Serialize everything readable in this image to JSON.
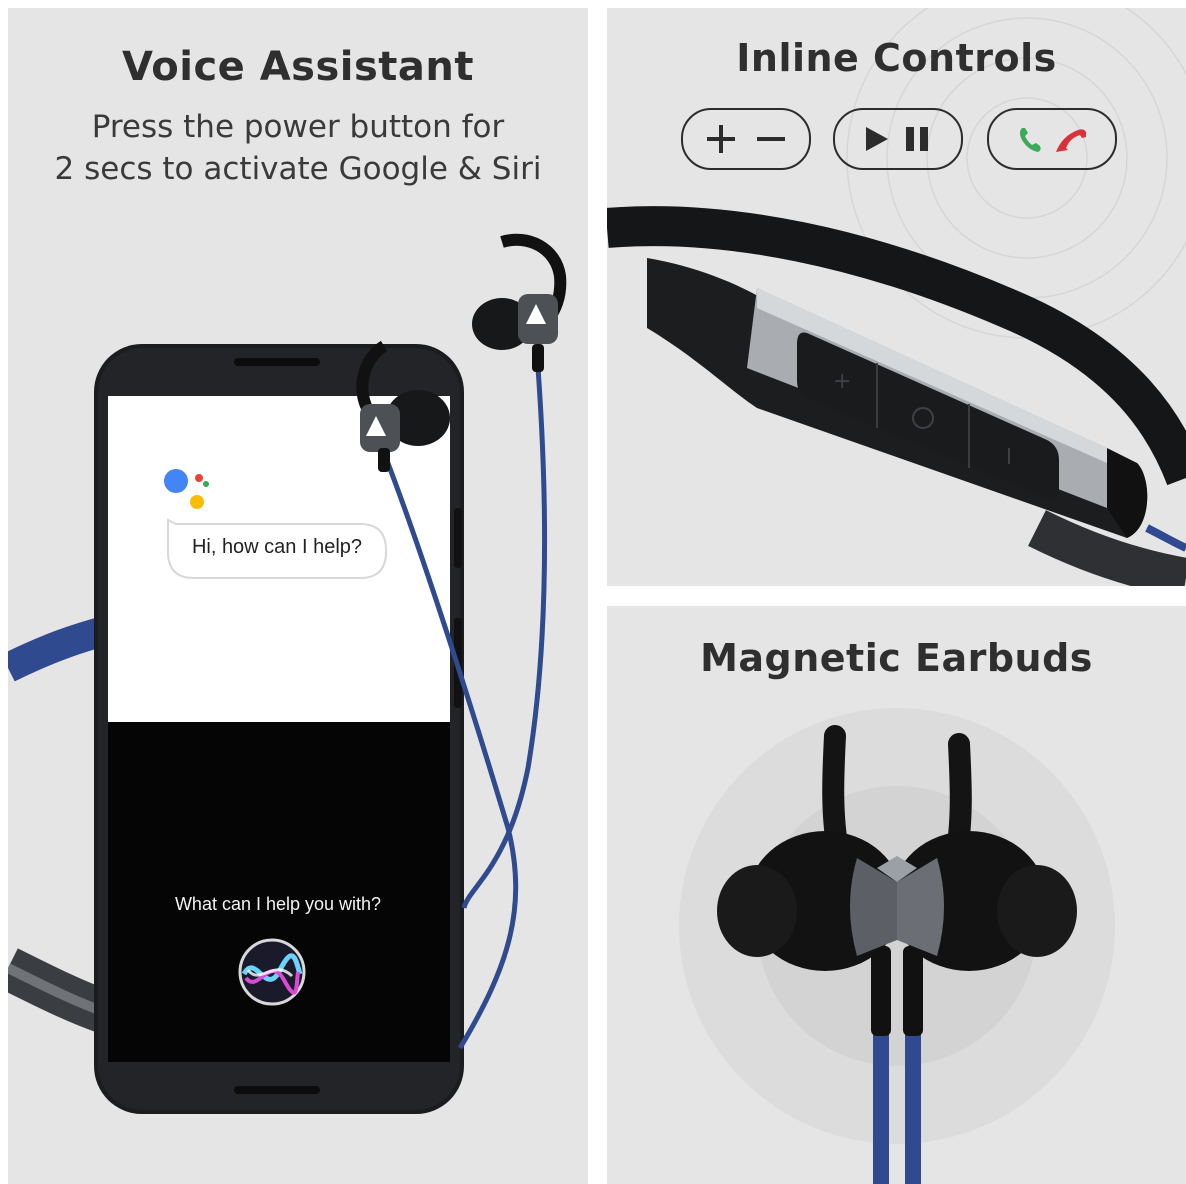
{
  "voice_assistant": {
    "title": "Voice Assistant",
    "subtitle_line1": "Press the power button for",
    "subtitle_line2": "2 secs to activate Google & Siri",
    "google_bubble": "Hi, how can I help?",
    "siri_prompt": "What can I help you with?"
  },
  "inline_controls": {
    "title": "Inline Controls",
    "controls": [
      {
        "icon": "plus-minus-icon"
      },
      {
        "icon": "play-pause-icon"
      },
      {
        "icon": "call-answer-end-icon"
      }
    ],
    "colors": {
      "answer": "#3daa5a",
      "end": "#d9313a"
    }
  },
  "magnetic_earbuds": {
    "title": "Magnetic Earbuds"
  },
  "colors": {
    "panel_bg": "#e5e5e5",
    "cable_blue": "#2f4a8f",
    "google_blue": "#4285f4",
    "google_red": "#ea4335",
    "google_yellow": "#fbbc05",
    "google_green": "#34a853"
  }
}
